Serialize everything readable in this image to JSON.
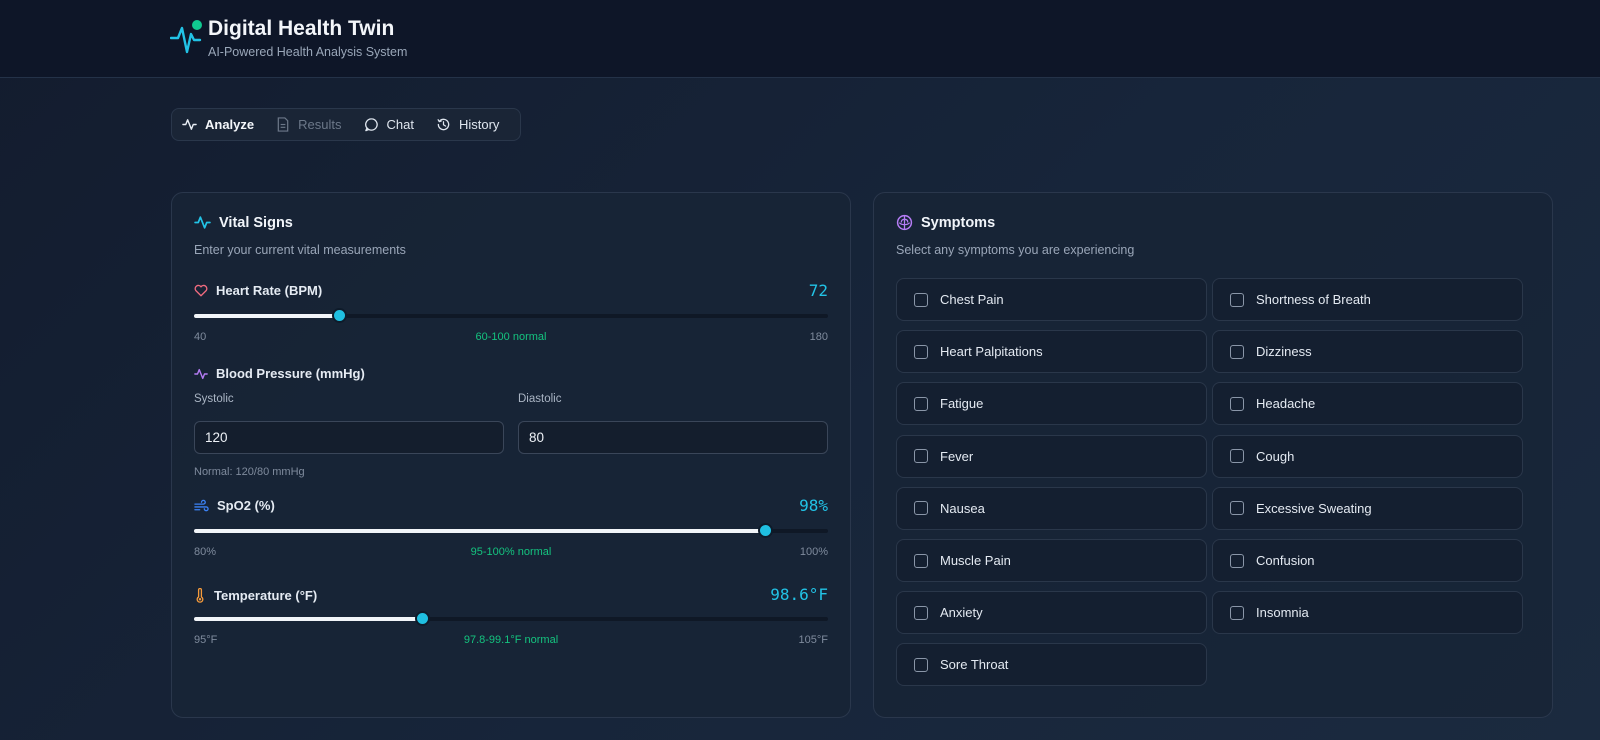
{
  "app": {
    "title": "Digital Health Twin",
    "subtitle": "AI-Powered Health Analysis System"
  },
  "tabs": [
    {
      "label": "Analyze",
      "icon": "pulse-icon",
      "state": "active"
    },
    {
      "label": "Results",
      "icon": "document-icon",
      "state": "disabled"
    },
    {
      "label": "Chat",
      "icon": "chat-bubble-icon",
      "state": "normal"
    },
    {
      "label": "History",
      "icon": "history-icon",
      "state": "normal"
    }
  ],
  "vitals": {
    "title": "Vital Signs",
    "subtitle": "Enter your current vital measurements",
    "heart_rate": {
      "label": "Heart Rate (BPM)",
      "value": 72,
      "display": "72",
      "min": 40,
      "max": 180,
      "min_label": "40",
      "max_label": "180",
      "normal": "60-100 normal",
      "icon": "heart-icon"
    },
    "blood_pressure": {
      "label": "Blood Pressure (mmHg)",
      "systolic_label": "Systolic",
      "diastolic_label": "Diastolic",
      "systolic": "120",
      "diastolic": "80",
      "note": "Normal: 120/80 mmHg",
      "icon": "pulse-icon"
    },
    "spo2": {
      "label": "SpO2 (%)",
      "value": 98,
      "display": "98%",
      "min": 80,
      "max": 100,
      "min_label": "80%",
      "max_label": "100%",
      "normal": "95-100% normal",
      "icon": "wind-icon"
    },
    "temperature": {
      "label": "Temperature (°F)",
      "value": 98.6,
      "display": "98.6°F",
      "min": 95,
      "max": 105,
      "min_label": "95°F",
      "max_label": "105°F",
      "normal": "97.8-99.1°F normal",
      "icon": "thermometer-icon"
    }
  },
  "symptoms": {
    "title": "Symptoms",
    "subtitle": "Select any symptoms you are experiencing",
    "items": [
      "Chest Pain",
      "Shortness of Breath",
      "Heart Palpitations",
      "Dizziness",
      "Fatigue",
      "Headache",
      "Fever",
      "Cough",
      "Nausea",
      "Excessive Sweating",
      "Muscle Pain",
      "Confusion",
      "Anxiety",
      "Insomnia",
      "Sore Throat"
    ]
  },
  "colors": {
    "accent": "#22c3e6",
    "normal_text": "#14c37f",
    "brand_dot": "#10c98f",
    "heart": "#f16b7f",
    "symptoms_icon": "#b57cf5",
    "temperature_icon": "#f59a3b"
  }
}
